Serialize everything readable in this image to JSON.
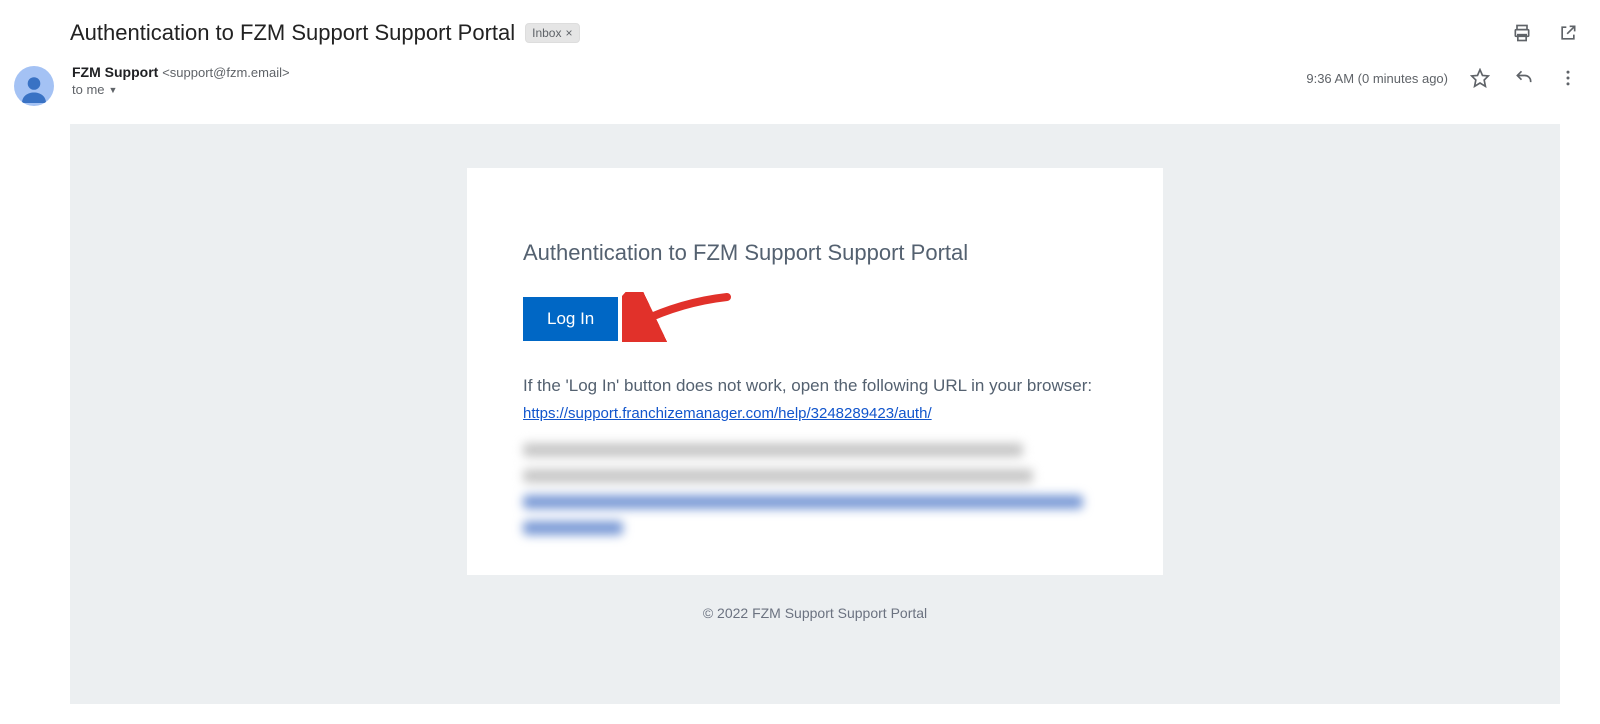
{
  "subject": {
    "title": "Authentication to FZM Support Support Portal",
    "label": "Inbox"
  },
  "sender": {
    "name": "FZM Support",
    "email": "<support@fzm.email>",
    "to_line": "to me"
  },
  "meta": {
    "timestamp": "9:36 AM (0 minutes ago)"
  },
  "body": {
    "title": "Authentication to FZM Support Support Portal",
    "login_label": "Log In",
    "fallback_text": "If the 'Log In' button does not work, open the following URL in your browser:",
    "auth_url": "https://support.franchizemanager.com/help/3248289423/auth/",
    "footer": "© 2022 FZM Support Support Portal"
  }
}
